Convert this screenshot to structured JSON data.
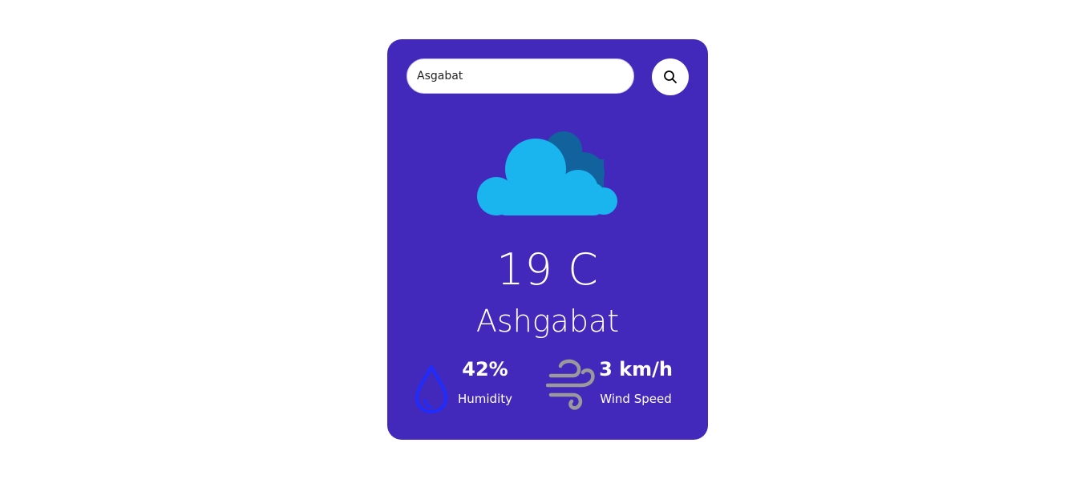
{
  "search": {
    "value": "Asgabat",
    "button_icon": "search-icon"
  },
  "weather": {
    "icon": "cloud-icon",
    "temperature": "19 C",
    "city": "Ashgabat"
  },
  "humidity": {
    "value": "42%",
    "label": "Humidity",
    "icon": "water-drop-icon"
  },
  "wind": {
    "value": "3 km/h",
    "label": "Wind Speed",
    "icon": "wind-icon"
  },
  "colors": {
    "card_background": "#4329bb",
    "cloud_front": "#1ab4ee",
    "cloud_back": "#12629e",
    "drop": "#1e2cff",
    "wind": "#9a9a9a",
    "text": "#ffffff"
  }
}
